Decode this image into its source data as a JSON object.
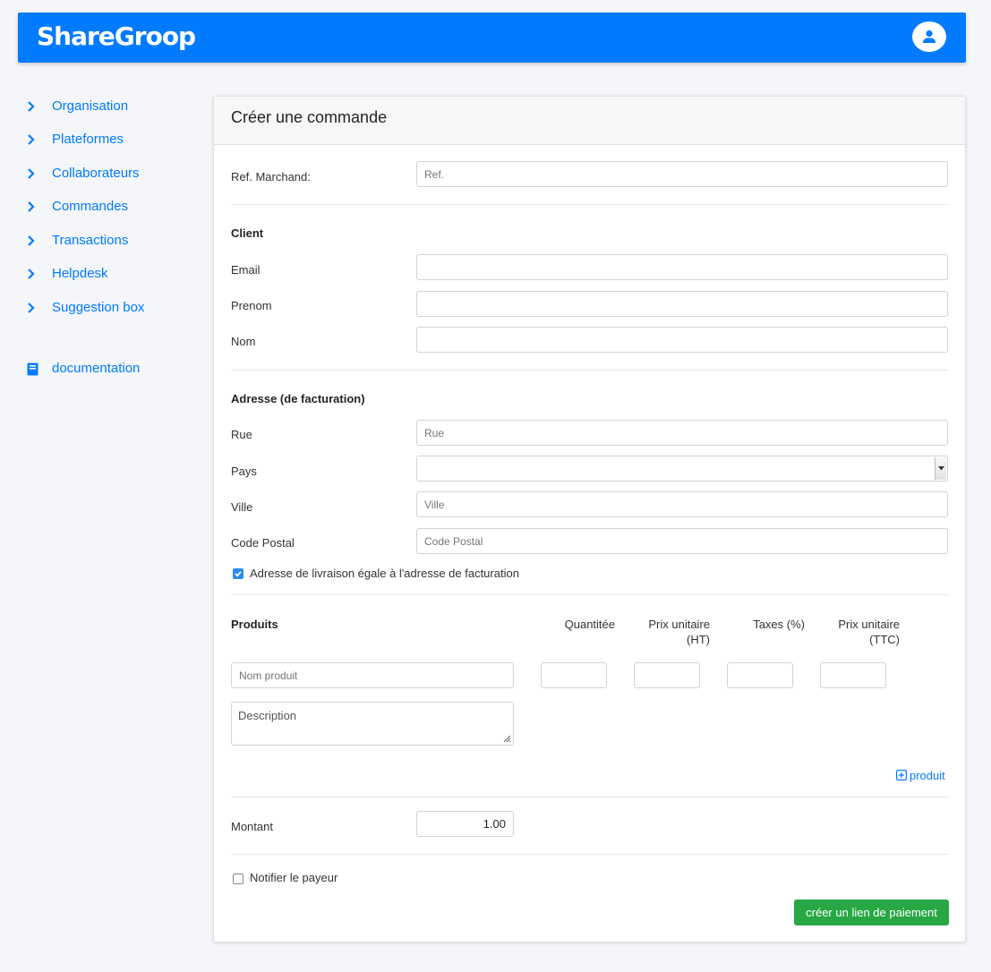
{
  "brand": {
    "logo_text": "ShareGroop",
    "accent": "#007bff"
  },
  "header": {
    "avatar_icon": "user-icon"
  },
  "sidebar": {
    "items": [
      {
        "label": "Organisation",
        "icon": "chevron-right-icon"
      },
      {
        "label": "Plateformes",
        "icon": "chevron-right-icon"
      },
      {
        "label": "Collaborateurs",
        "icon": "chevron-right-icon"
      },
      {
        "label": "Commandes",
        "icon": "chevron-right-icon"
      },
      {
        "label": "Transactions",
        "icon": "chevron-right-icon"
      },
      {
        "label": "Helpdesk",
        "icon": "chevron-right-icon"
      },
      {
        "label": "Suggestion box",
        "icon": "chevron-right-icon"
      }
    ],
    "documentation": {
      "label": "documentation",
      "icon": "book-icon"
    }
  },
  "form": {
    "title": "Créer une commande",
    "ref": {
      "label": "Ref. Marchand:",
      "placeholder": "Ref.",
      "value": ""
    },
    "client": {
      "heading": "Client",
      "email_label": "Email",
      "prenom_label": "Prenom",
      "nom_label": "Nom"
    },
    "address": {
      "heading": "Adresse (de facturation)",
      "rue_label": "Rue",
      "rue_placeholder": "Rue",
      "pays_label": "Pays",
      "pays_value": "",
      "ville_label": "Ville",
      "ville_placeholder": "Ville",
      "cp_label": "Code Postal",
      "cp_placeholder": "Code Postal",
      "same_delivery_label": "Adresse de livraison égale à l'adresse de facturation",
      "same_delivery_checked": true
    },
    "products": {
      "heading": "Produits",
      "col_quantity": "Quantitée",
      "col_unit_ht_1": "Prix unitaire",
      "col_unit_ht_2": "(HT)",
      "col_taxes": "Taxes (%)",
      "col_unit_ttc_1": "Prix unitaire",
      "col_unit_ttc_2": "(TTC)",
      "name_placeholder": "Nom produit",
      "description_placeholder": "Description",
      "add_label": "produit",
      "add_icon": "plus-square-icon"
    },
    "amount": {
      "label": "Montant",
      "value": "1.00"
    },
    "notify": {
      "label": "Notifier le payeur",
      "checked": false
    },
    "submit_label": "créer un lien de paiement"
  }
}
